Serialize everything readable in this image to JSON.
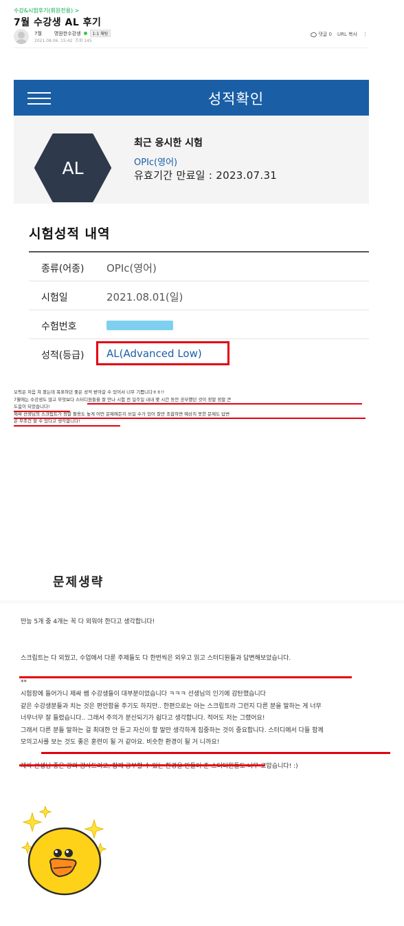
{
  "post": {
    "breadcrumb": "수강&시험후기(회원전용) >",
    "title": "7월 수강생 AL 후기",
    "author": "7월",
    "author_nick": "명원한수강생",
    "grade_badge": "1:1 채팅",
    "datetime": "2021.08.06. 15:42",
    "views": "조회 145",
    "comment_label": "댓글 0",
    "url_copy_label": "URL 복사",
    "more_label": "⋮"
  },
  "score_screen": {
    "header_title": "성적확인",
    "level": "AL",
    "recent_title": "최근 응시한 시험",
    "recent_exam": "OPIc(영어)",
    "expiry": "유효기간 만료일 : 2023.07.31",
    "history_title": "시험성적 내역",
    "rows": [
      {
        "label": "종류(어종)",
        "value": "OPIc(영어)"
      },
      {
        "label": "시험일",
        "value": "2021.08.01(일)"
      },
      {
        "label": "수험번호",
        "value": ""
      },
      {
        "label": "성적(등급)",
        "value": "AL(Advanced Low)"
      }
    ]
  },
  "review_small": [
    "오픽은 처음 쳐 봤는데 목표하던 좋은 성적 받아갈 수 있어서 너무 기쁩니다ㅎㅎ!!",
    "7월에는 수강생도 많고 무엇보다 스터디원들을 잘 만나 시험 전 일주일 내내 몇 시간 동안 공부했던 것이 정말 정말 큰",
    "도움이 되었습니다!",
    "제싸 선생님의 스크립트가 정말 활용도 높게 어떤 문제에든지 쓰일 수가 있어 잘만 조합하면 예상치 못한 문제도 답변",
    "은 무조건 할 수 있다고 생각합니다!"
  ],
  "section_title": "문제생략",
  "body": [
    "만능 5개 중 4개는 꼭 다 외워야 한다고 생각합니다!",
    "",
    "",
    "스크립트는 다 외웠고, 수업에서 다룬 주제들도 다 한번씩은 외우고 읽고 스터디원들과 답변해보았습니다.",
    "",
    "**",
    "시험장에 들어가니 제싸 쌤 수강생들이 대부분이었습니다 ㅋㅋㅋ 선생님의 인기에 감탄했습니다",
    "같은 수강생분들과 치는 것은 편안함을 주기도 하지만.. 한편으로는 아는 스크립트라 그런지 다른 분을 말하는 게 너무",
    "너무너무 잘 들렸습니다.. 그래서 주의가 분산되기가 쉽다고 생각합니다. 적어도 저는 그랬어요!",
    "그래서 다른 분들 말하는 걸 최대한 안 듣고 자신이 할 말만 생각하게 집중하는 것이 중요합니다. 스터디에서 다들 함께",
    "모의고사를 보는 것도 좋은 훈련이 될 거 같아요. 비슷한 환경이 될 거 니까요!",
    "",
    "제싸 선생님 좋은 강의 감사드리고, 함께 공부할 수 있는 환경을 만들어 준 스터디원들도 너무 고맙습니다! :)"
  ],
  "colors": {
    "brand_blue": "#1a5ea6",
    "highlight_red": "#e3000f",
    "cafe_green": "#03a94f",
    "hex_navy": "#2e3a4b"
  },
  "icons": [
    "hamburger-icon",
    "comment-icon",
    "more-icon",
    "sticker-sally"
  ]
}
